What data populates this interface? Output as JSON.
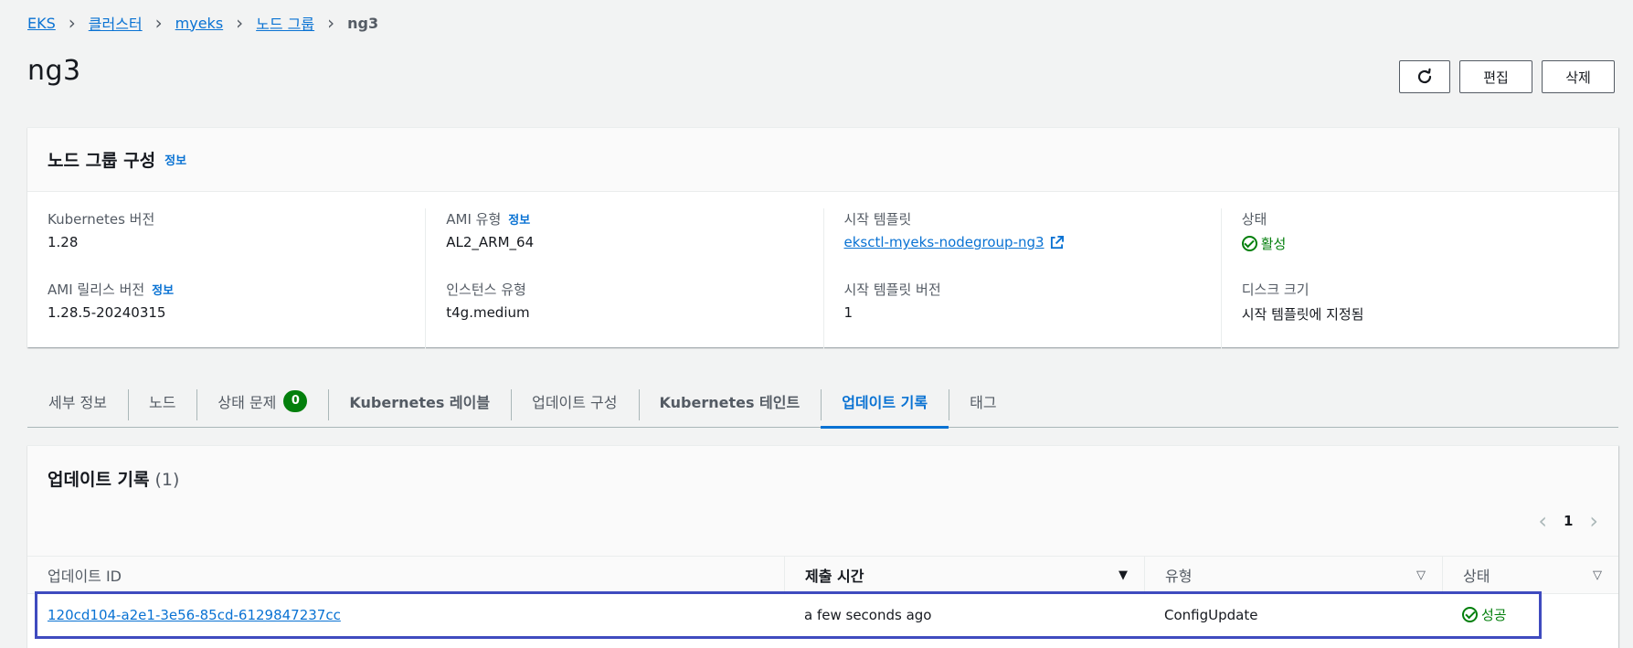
{
  "breadcrumb": {
    "items": [
      "EKS",
      "클러스터",
      "myeks",
      "노드 그룹"
    ],
    "current": "ng3"
  },
  "page": {
    "title": "ng3",
    "edit_label": "편집",
    "delete_label": "삭제"
  },
  "config": {
    "title": "노드 그룹 구성",
    "info": "정보",
    "fields": {
      "k8s_version_label": "Kubernetes 버전",
      "k8s_version_value": "1.28",
      "ami_release_label": "AMI 릴리스 버전",
      "ami_release_value": "1.28.5-20240315",
      "ami_type_label": "AMI 유형",
      "ami_type_value": "AL2_ARM_64",
      "instance_type_label": "인스턴스 유형",
      "instance_type_value": "t4g.medium",
      "launch_template_label": "시작 템플릿",
      "launch_template_value": "eksctl-myeks-nodegroup-ng3",
      "launch_template_version_label": "시작 템플릿 버전",
      "launch_template_version_value": "1",
      "status_label": "상태",
      "status_value": "활성",
      "disk_size_label": "디스크 크기",
      "disk_size_value": "시작 템플릿에 지정됨"
    }
  },
  "tabs": [
    {
      "label": "세부 정보"
    },
    {
      "label": "노드"
    },
    {
      "label": "상태 문제",
      "badge": "0"
    },
    {
      "label": "Kubernetes 레이블"
    },
    {
      "label": "업데이트 구성"
    },
    {
      "label": "Kubernetes 테인트"
    },
    {
      "label": "업데이트 기록"
    },
    {
      "label": "태그"
    }
  ],
  "updates": {
    "title": "업데이트 기록",
    "count": "(1)",
    "page": "1",
    "columns": {
      "id": "업데이트 ID",
      "time": "제출 시간",
      "type": "유형",
      "status": "상태"
    },
    "rows": [
      {
        "id": "120cd104-a2e1-3e56-85cd-6129847237cc",
        "time": "a few seconds ago",
        "type": "ConfigUpdate",
        "status": "성공"
      }
    ]
  },
  "colors": {
    "link": "#0972d3",
    "success": "#037f0c",
    "highlight": "#3f4bbf"
  }
}
